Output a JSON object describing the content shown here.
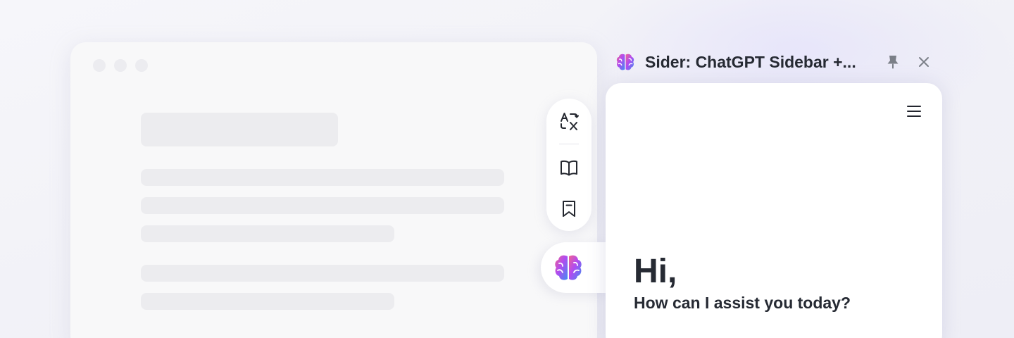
{
  "sidebar": {
    "title": "Sider: ChatGPT Sidebar +...",
    "logo_icon": "sider-brain-logo-icon",
    "pin_icon": "pin-icon",
    "close_icon": "close-icon",
    "menu_icon": "hamburger-menu-icon",
    "greeting": "Hi,",
    "subgreeting": "How can I assist you today?"
  },
  "toolbar": {
    "items": [
      {
        "icon": "translate-icon"
      },
      {
        "icon": "book-reader-icon"
      },
      {
        "icon": "bookmark-icon"
      }
    ]
  },
  "launcher": {
    "icon": "sider-brain-logo-icon"
  },
  "colors": {
    "text": "#262a33",
    "brand_pink": "#e64fb0",
    "brand_purple": "#8a53f0",
    "brand_blue": "#3f8cf2",
    "skeleton": "#ececef"
  }
}
